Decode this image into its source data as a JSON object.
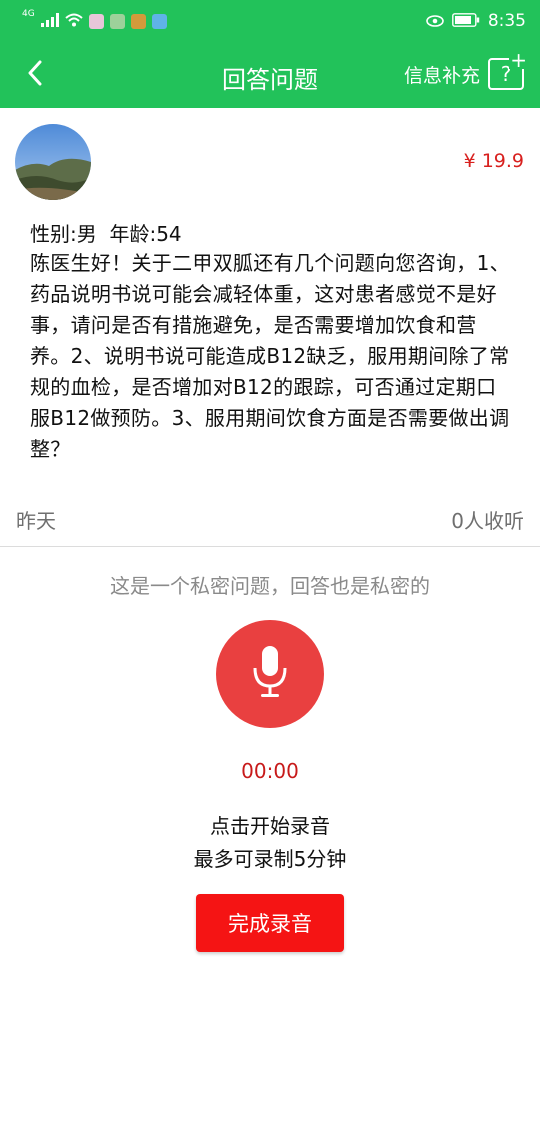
{
  "status_bar": {
    "signal_label": "4G",
    "time": "8:35",
    "icons": [
      "signal-icon",
      "wifi-icon",
      "app-notification-icons",
      "eye-icon",
      "battery-icon"
    ]
  },
  "nav": {
    "title": "回答问题",
    "right_label": "信息补充",
    "right_icon_glyph": "?",
    "right_icon_plus": "+"
  },
  "question": {
    "price": "¥ 19.9",
    "profile": "性别:男  年龄:54",
    "text": "陈医生好！关于二甲双胍还有几个问题向您咨询，1、药品说明书说可能会减轻体重，这对患者感觉不是好事，请问是否有措施避免，是否需要增加饮食和营养。2、说明书说可能造成B12缺乏，服用期间除了常规的血检，是否增加对B12的跟踪，可否通过定期口服B12做预防。3、服用期间饮食方面是否需要做出调整？",
    "time": "昨天",
    "listeners": "0人收听"
  },
  "recorder": {
    "private_note": "这是一个私密问题，回答也是私密的",
    "timer": "00:00",
    "hint_start": "点击开始录音",
    "hint_limit": "最多可录制5分钟",
    "finish_label": "完成录音"
  },
  "colors": {
    "brand_green": "#22c25a",
    "price_red": "#d8201e",
    "mic_red": "#e94040",
    "button_red": "#f51414"
  }
}
